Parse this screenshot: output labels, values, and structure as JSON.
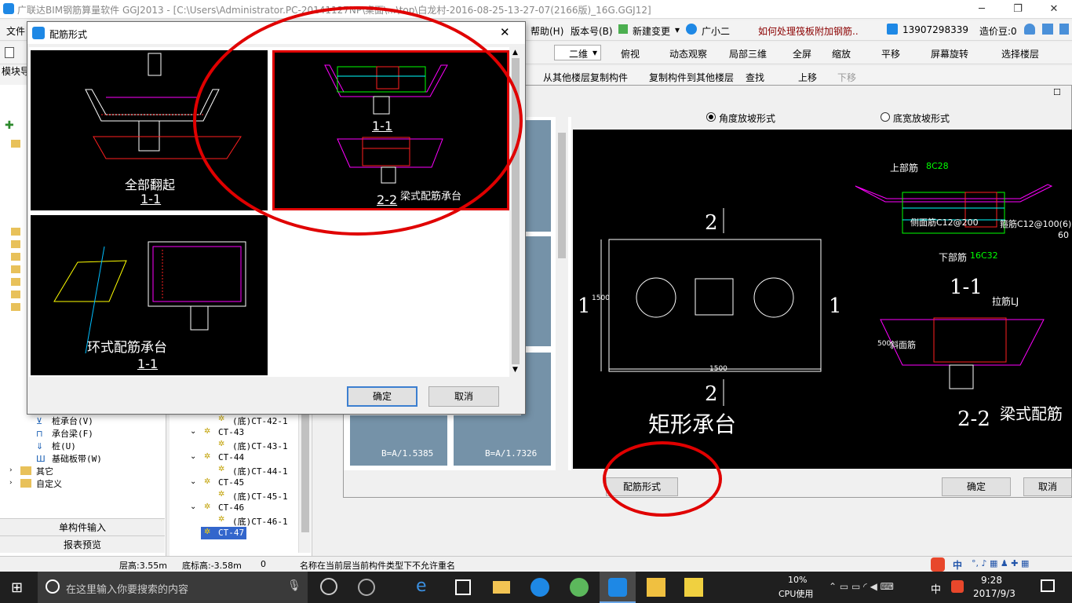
{
  "app": {
    "title": "广联达BIM钢筋算量软件 GGJ2013 - [C:\\Users\\Administrator.PC-20141127NP\\桌面\\...\\top\\白龙村-2016-08-25-13-27-07(2166版)_16G.GGJ12]"
  },
  "menu": {
    "file": "文件",
    "help": "帮助(H)",
    "version": "版本号(B)",
    "new_change": "新建变更",
    "assistant": "广小二",
    "ad": "如何处理筏板附加钢筋..",
    "phone": "13907298339",
    "beans": "造价豆:0"
  },
  "toolbar": {
    "view_2d": "二维",
    "top_view": "俯视",
    "dynamic": "动态观察",
    "local3d": "局部三维",
    "fullscreen": "全屏",
    "zoom": "缩放",
    "pan": "平移",
    "rotate": "屏幕旋转",
    "select_floor": "选择楼层",
    "copy_from": "从其他楼层复制构件",
    "copy_to": "复制构件到其他楼层",
    "find": "查找",
    "move_up": "上移",
    "move_down": "下移"
  },
  "left": {
    "module_nav": "模块导",
    "items": [
      "桩承台(V)",
      "承台梁(F)",
      "桩(U)",
      "基础板带(W)",
      "其它",
      "自定义"
    ],
    "single_input": "单构件输入",
    "report": "报表预览"
  },
  "tree": {
    "items": [
      "(底)CT-42-1",
      "CT-43",
      "(底)CT-43-1",
      "CT-44",
      "(底)CT-44-1",
      "CT-45",
      "(底)CT-45-1",
      "CT-46",
      "(底)CT-46-1",
      "CT-47"
    ]
  },
  "bigdialog": {
    "radio_angle": "角度放坡形式",
    "radio_width": "底宽放坡形式",
    "preview_title": "矩形承台",
    "section11": "1-1",
    "section22": "2-2",
    "beam_label": "梁式配筋",
    "top_bar": "上部筋",
    "top_bar_val": "8C28",
    "side_bar": "侧面筋C12@200",
    "stirrup": "箍筋C12@100(6)",
    "bottom_bar": "下部筋",
    "bottom_bar_val": "16C32",
    "tie_bar": "拉筋LJ",
    "slope_bar": "斜面筋",
    "dim1500": "1500",
    "angle": "60",
    "thumb1": "B=A/1.5385",
    "thumb2": "B=A/1.7326",
    "rebar_btn": "配筋形式",
    "ok": "确定",
    "cancel": "取消",
    "mark1": "1",
    "mark2": "2",
    "dim500": "500"
  },
  "dialog": {
    "title": "配筋形式",
    "opt1": "全部翻起",
    "opt1_sec": "1-1",
    "opt2": "梁式配筋承台",
    "opt2_sec1": "1-1",
    "opt2_sec2": "2-2",
    "opt3": "环式配筋承台",
    "opt3_sec": "1-1",
    "ok": "确定",
    "cancel": "取消"
  },
  "status": {
    "floor_h": "层高:3.55m",
    "bottom_h": "底标高:-3.58m",
    "zero": "0",
    "msg": "名称在当前层当前构件类型下不允许重名"
  },
  "taskbar": {
    "search": "在这里输入你要搜索的内容",
    "cpu": "10%",
    "cpu_label": "CPU使用",
    "ime": "中",
    "time": "9:28",
    "date": "2017/9/3"
  },
  "colors": {
    "highlight": "#e00000",
    "accent": "#3c7fd0"
  }
}
